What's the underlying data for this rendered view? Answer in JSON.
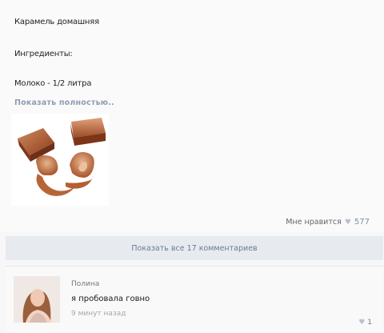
{
  "post": {
    "title": "Карамель домашняя",
    "ingredients_label": "Ингредиенты:",
    "ingredient_line": "Молоко - 1/2 литра",
    "show_more": "Показать полностью..",
    "likes_label": "Мне нравится",
    "likes_count": "577"
  },
  "comments_bar": {
    "label": "Показать все 17 комментариев"
  },
  "comment": {
    "author": "Полина",
    "text": "я пробовала говно",
    "time": "9 минут назад",
    "likes": "1"
  },
  "icons": {
    "like": "heart-icon"
  }
}
